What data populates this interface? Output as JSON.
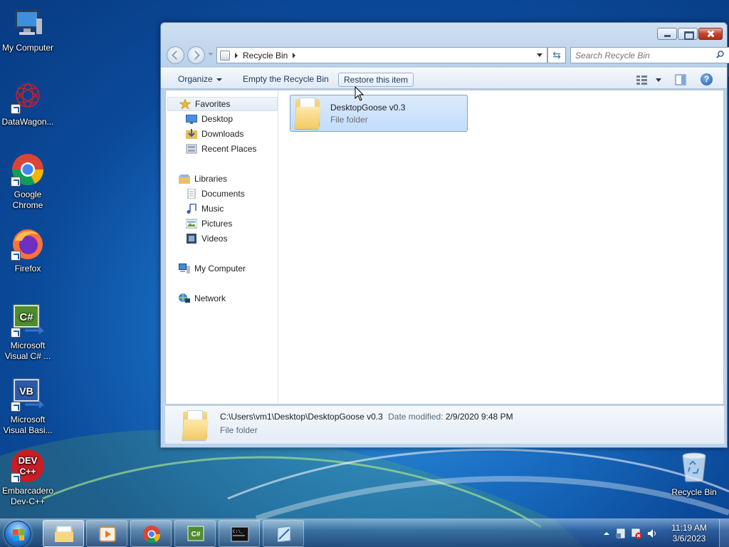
{
  "desktop": {
    "icons": [
      {
        "label": "My Computer",
        "icon": "computer-icon"
      },
      {
        "label": "DataWagon...",
        "icon": "datawagon-icon"
      },
      {
        "label": "Google Chrome",
        "icon": "chrome-icon"
      },
      {
        "label": "Firefox",
        "icon": "firefox-icon"
      },
      {
        "label": "Microsoft Visual C# ...",
        "icon": "visual-csharp-icon"
      },
      {
        "label": "Microsoft Visual Basi...",
        "icon": "visual-basic-icon"
      },
      {
        "label": "Embarcadero Dev-C++",
        "icon": "devcpp-icon"
      },
      {
        "label": "Recycle Bin",
        "icon": "recycle-bin-icon"
      }
    ]
  },
  "window": {
    "address": {
      "crumb": "Recycle Bin"
    },
    "search": {
      "placeholder": "Search Recycle Bin"
    },
    "toolbar": {
      "organize": "Organize",
      "empty": "Empty the Recycle Bin",
      "restore": "Restore this item"
    },
    "nav": {
      "favorites": "Favorites",
      "desktop": "Desktop",
      "downloads": "Downloads",
      "recent": "Recent Places",
      "libraries": "Libraries",
      "documents": "Documents",
      "music": "Music",
      "pictures": "Pictures",
      "videos": "Videos",
      "computer": "My Computer",
      "network": "Network"
    },
    "items": [
      {
        "name": "DesktopGoose v0.3",
        "type": "File folder"
      }
    ],
    "details": {
      "path": "C:\\Users\\vm1\\Desktop\\DesktopGoose v0.3",
      "modified_label": "Date modified:",
      "modified_value": "2/9/2020 9:48 PM",
      "type": "File folder"
    }
  },
  "taskbar": {
    "clock_time": "11:19 AM",
    "clock_date": "3/6/2023",
    "apps": [
      "explorer-icon",
      "media-player-icon",
      "chrome-icon",
      "visual-csharp-icon",
      "cmd-icon",
      "notepad-icon"
    ]
  }
}
